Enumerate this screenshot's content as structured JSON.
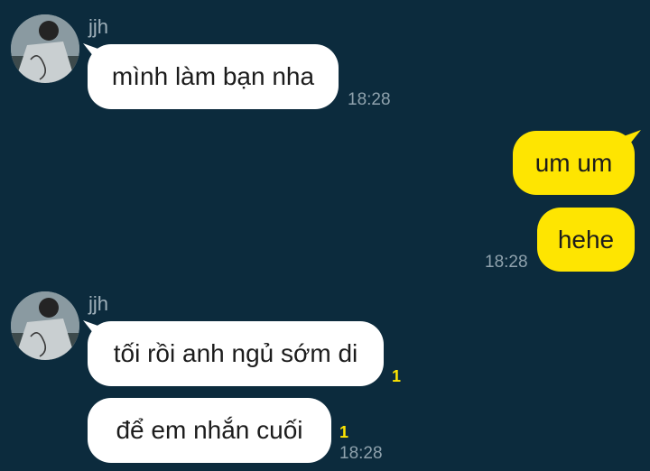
{
  "chat": {
    "groups": [
      {
        "sender": "jjh",
        "avatar_icon": "profile-photo-icon",
        "messages": [
          {
            "text": "mình làm bạn nha",
            "time": "18:28"
          }
        ]
      },
      {
        "sender": "me",
        "messages": [
          {
            "text": "um um"
          },
          {
            "text": "hehe",
            "time": "18:28"
          }
        ]
      },
      {
        "sender": "jjh",
        "avatar_icon": "profile-photo-icon",
        "messages": [
          {
            "text": "tối rồi anh ngủ sớm di",
            "unread": "1"
          },
          {
            "text": "để em nhắn cuối",
            "unread": "1",
            "time": "18:28"
          }
        ]
      }
    ]
  },
  "colors": {
    "background": "#0c2b3d",
    "incoming_bubble": "#ffffff",
    "outgoing_bubble": "#fee501",
    "unread_count": "#fee501"
  }
}
